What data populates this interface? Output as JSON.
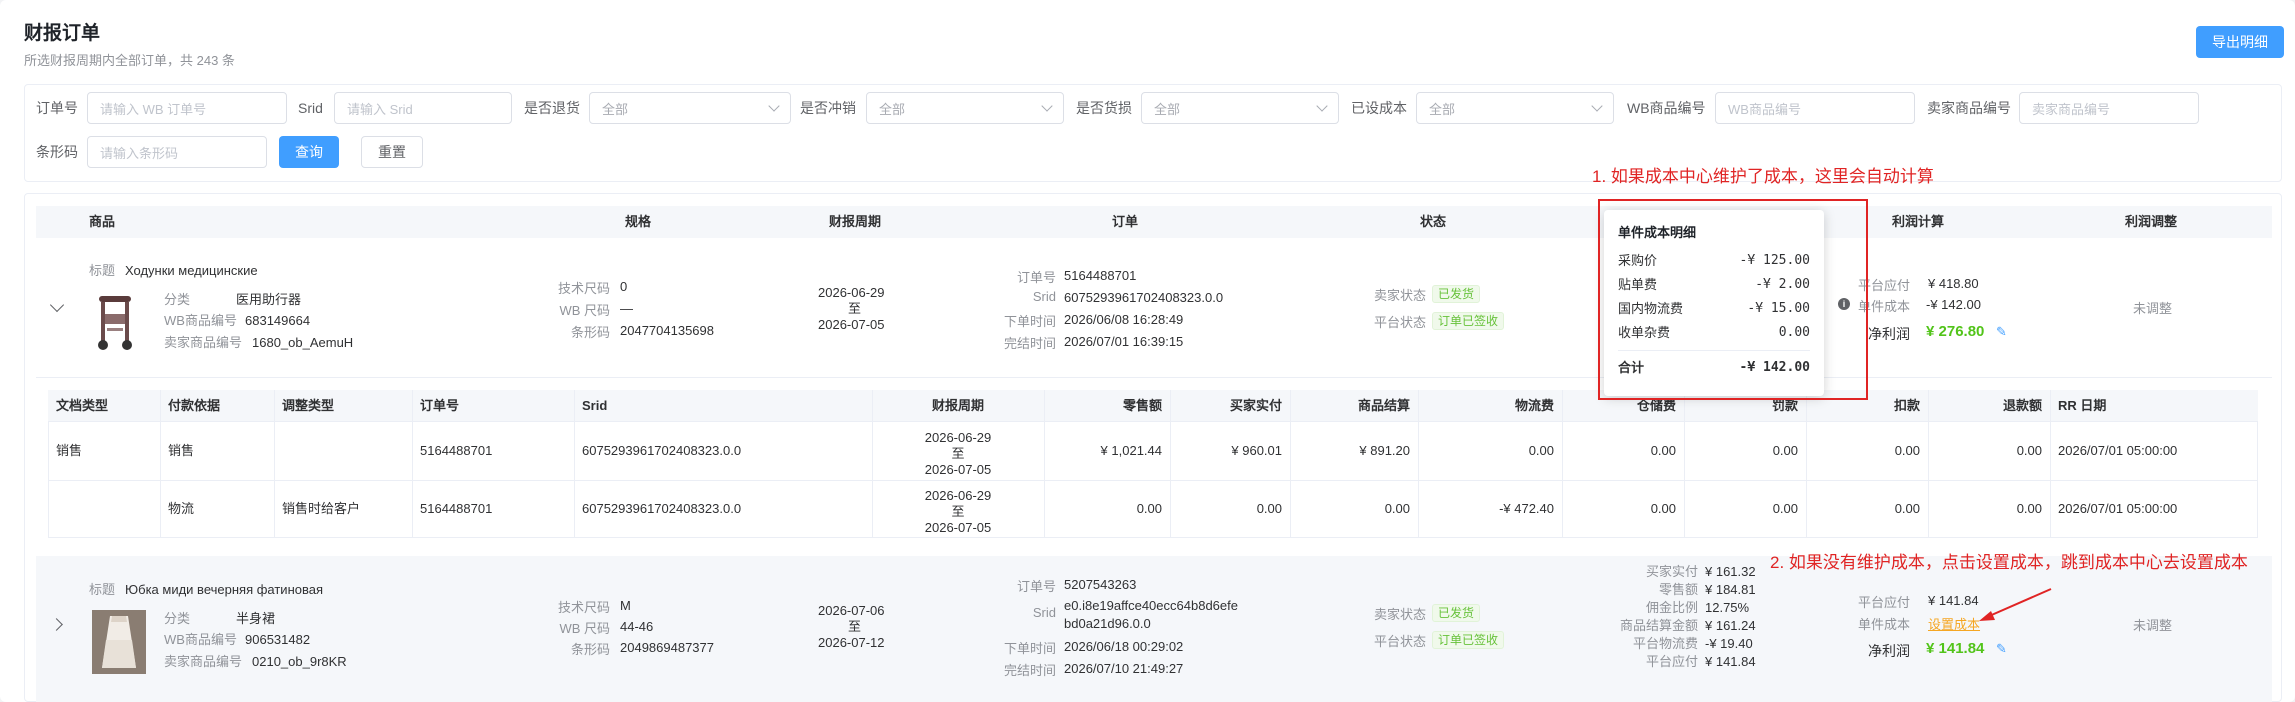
{
  "header": {
    "title": "财报订单",
    "subtitle": "所选财报周期内全部订单，共 243 条",
    "export_label": "导出明细"
  },
  "filters": {
    "order_no": {
      "label": "订单号",
      "placeholder": "请输入 WB 订单号"
    },
    "srid": {
      "label": "Srid",
      "placeholder": "请输入 Srid"
    },
    "is_return": {
      "label": "是否退货",
      "value": "全部"
    },
    "is_offset": {
      "label": "是否冲销",
      "value": "全部"
    },
    "is_damage": {
      "label": "是否货损",
      "value": "全部"
    },
    "cost_set": {
      "label": "已设成本",
      "value": "全部"
    },
    "wb_sku": {
      "label": "WB商品编号",
      "placeholder": "WB商品编号"
    },
    "seller_sku": {
      "label": "卖家商品编号",
      "placeholder": "卖家商品编号"
    },
    "barcode": {
      "label": "条形码",
      "placeholder": "请输入条形码"
    },
    "query_label": "查询",
    "reset_label": "重置"
  },
  "columns": {
    "product": "商品",
    "spec": "规格",
    "period": "财报周期",
    "order": "订单",
    "status": "状态",
    "profit": "利润计算",
    "adjust": "利润调整"
  },
  "orders": [
    {
      "title_label": "标题",
      "title": "Ходунки медицинские",
      "category_label": "分类",
      "category": "医用助行器",
      "wb_sku_label": "WB商品编号",
      "wb_sku": "683149664",
      "seller_sku_label": "卖家商品编号",
      "seller_sku": "1680_ob_AemuH",
      "tech_size_label": "技术尺码",
      "tech_size": "0",
      "wb_size_label": "WB 尺码",
      "wb_size": "—",
      "barcode_label": "条形码",
      "barcode": "2047704135698",
      "period_start": "2026-06-29",
      "period_to": "至",
      "period_end": "2026-07-05",
      "order_no_label": "订单号",
      "order_no": "5164488701",
      "srid_label": "Srid",
      "srid": "6075293961702408323.0.0",
      "order_time_label": "下单时间",
      "order_time": "2026/06/08 16:28:49",
      "done_time_label": "完结时间",
      "done_time": "2026/07/01 16:39:15",
      "seller_status_label": "卖家状态",
      "seller_status": "已发货",
      "platform_status_label": "平台状态",
      "platform_status": "订单已签收",
      "platform_due_label": "平台应付",
      "platform_due": "¥ 418.80",
      "unit_cost_label": "单件成本",
      "unit_cost": "-¥ 142.00",
      "net_profit_label": "净利润",
      "net_profit": "¥ 276.80",
      "adjust": "未调整"
    },
    {
      "title_label": "标题",
      "title": "Юбка миди вечерняя фатиновая",
      "category_label": "分类",
      "category": "半身裙",
      "wb_sku_label": "WB商品编号",
      "wb_sku": "906531482",
      "seller_sku_label": "卖家商品编号",
      "seller_sku": "0210_ob_9r8KR",
      "tech_size_label": "技术尺码",
      "tech_size": "M",
      "wb_size_label": "WB 尺码",
      "wb_size": "44-46",
      "barcode_label": "条形码",
      "barcode": "2049869487377",
      "period_start": "2026-07-06",
      "period_to": "至",
      "period_end": "2026-07-12",
      "order_no_label": "订单号",
      "order_no": "5207543263",
      "srid_label": "Srid",
      "srid_line1": "e0.i8e19affce40ecc64b8d6efe",
      "srid_line2": "bd0a21d96.0.0",
      "order_time_label": "下单时间",
      "order_time": "2026/06/18 00:29:02",
      "done_time_label": "完结时间",
      "done_time": "2026/07/10 21:49:27",
      "seller_status_label": "卖家状态",
      "seller_status": "已发货",
      "platform_status_label": "平台状态",
      "platform_status": "订单已签收",
      "amounts": [
        {
          "label": "买家实付",
          "value": "¥ 161.32"
        },
        {
          "label": "零售额",
          "value": "¥ 184.81"
        },
        {
          "label": "佣金比例",
          "value": "12.75%"
        },
        {
          "label": "商品结算金额",
          "value": "¥ 161.24"
        },
        {
          "label": "平台物流费",
          "value": "-¥ 19.40"
        },
        {
          "label": "平台应付",
          "value": "¥ 141.84"
        }
      ],
      "platform_due_label": "平台应付",
      "platform_due": "¥ 141.84",
      "unit_cost_label": "单件成本",
      "unit_cost_link": "设置成本",
      "net_profit_label": "净利润",
      "net_profit": "¥ 141.84",
      "adjust": "未调整"
    }
  ],
  "detail_table": {
    "headers": [
      "文档类型",
      "付款依据",
      "调整类型",
      "订单号",
      "Srid",
      "财报周期",
      "零售额",
      "买家实付",
      "商品结算",
      "物流费",
      "仓储费",
      "罚款",
      "扣款",
      "退款额",
      "RR 日期"
    ],
    "rows": [
      [
        "销售",
        "销售",
        "",
        "5164488701",
        "6075293961702408323.0.0",
        "2026-06-29|至|2026-07-05",
        "¥ 1,021.44",
        "¥ 960.01",
        "¥ 891.20",
        "0.00",
        "0.00",
        "0.00",
        "0.00",
        "0.00",
        "2026/07/01 05:00:00"
      ],
      [
        "",
        "物流",
        "销售时给客户",
        "5164488701",
        "6075293961702408323.0.0",
        "2026-06-29|至|2026-07-05",
        "0.00",
        "0.00",
        "0.00",
        "-¥ 472.40",
        "0.00",
        "0.00",
        "0.00",
        "0.00",
        "2026/07/01 05:00:00"
      ]
    ]
  },
  "popover": {
    "title": "单件成本明细",
    "rows": [
      {
        "label": "采购价",
        "value": "-¥ 125.00"
      },
      {
        "label": "贴单费",
        "value": "-¥ 2.00"
      },
      {
        "label": "国内物流费",
        "value": "-¥ 15.00"
      },
      {
        "label": "收单杂费",
        "value": "0.00"
      }
    ],
    "total_label": "合计",
    "total_value": "-¥ 142.00"
  },
  "annotations": {
    "note1": "1. 如果成本中心维护了成本，这里会自动计算",
    "note2": "2. 如果没有维护成本，点击设置成本，跳到成本中心去设置成本"
  },
  "colors": {
    "primary": "#409eff",
    "success": "#52c41a",
    "annotation": "#e02424",
    "link_orange": "#f5a623"
  },
  "icons": {
    "expand": "chevron-down-icon",
    "collapse": "chevron-right-icon",
    "info": "info-icon",
    "edit": "edit-icon"
  }
}
